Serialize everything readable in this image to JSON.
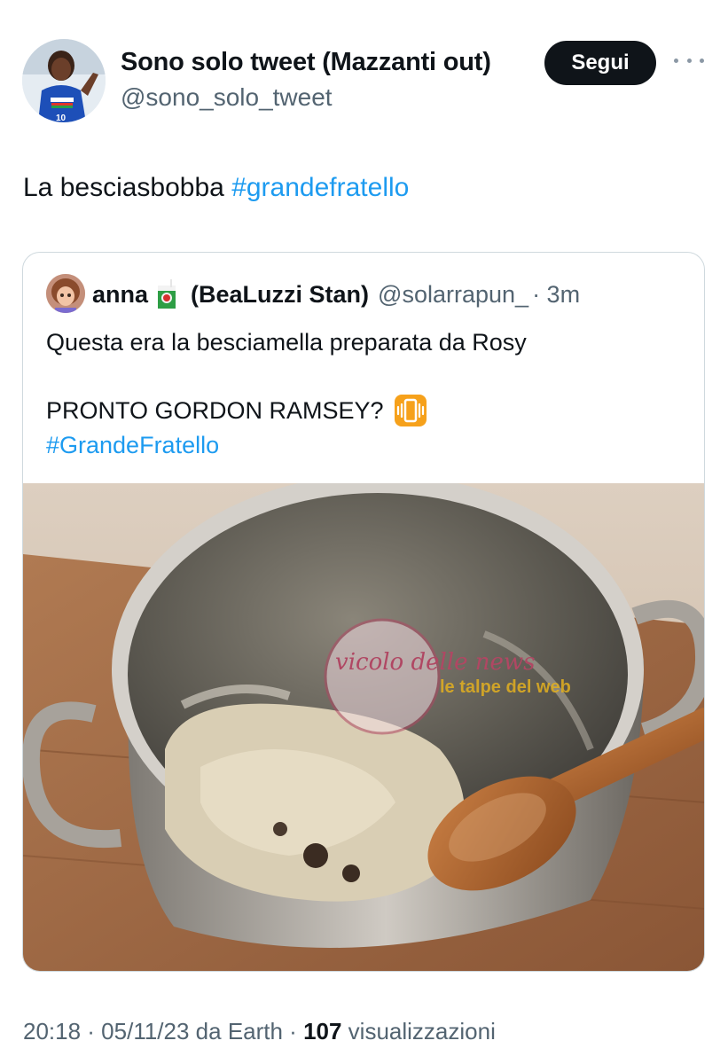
{
  "author": {
    "display_name": "Sono solo tweet (Mazzanti out)",
    "handle": "@sono_solo_tweet",
    "avatar_icon": "volleyball-player-avatar"
  },
  "follow_label": "Segui",
  "more_icon": "more-horizontal-icon",
  "tweet": {
    "text": "La besciasbobba ",
    "hashtag": "#grandefratello"
  },
  "quote": {
    "name": "anna",
    "emoji": "juice-box-emoji",
    "stan": "(BeaLuzzi Stan)",
    "handle": "@solarrapun_",
    "time": "· 3m",
    "line1": "Questa era la besciamella preparata da Rosy",
    "line2": "PRONTO GORDON RAMSEY?",
    "line2_icon": "vibration-mode-emoji",
    "line3": "#GrandeFratello",
    "image_icon": "pot-with-bechamel-photo",
    "watermark1": "vicolo delle news",
    "watermark2": "le talpe del web"
  },
  "footer": {
    "time": "20:18 · 05/11/23 da Earth · ",
    "views_count": "107",
    "views_label": " visualizzazioni"
  },
  "colors": {
    "link": "#1d9bf0",
    "secondary": "#536471",
    "button": "#0f1419"
  }
}
